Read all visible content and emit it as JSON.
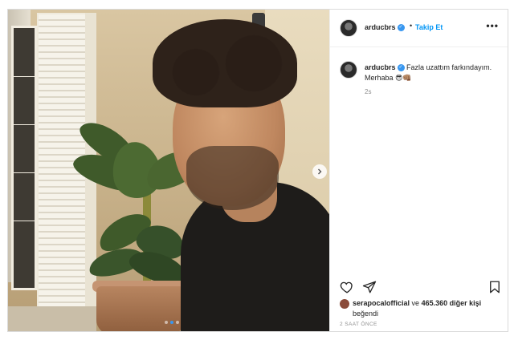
{
  "post": {
    "username": "arducbrs",
    "follow_label": "Takip Et",
    "separator": "•",
    "more_icon": "•••",
    "caption_username": "arducbrs",
    "caption_text": "Fazla uzattım farkındayım. Merhaba 😎👊🏽",
    "caption_time": "2s",
    "likes_user": "serapocalofficial",
    "likes_connector": "ve",
    "likes_count": "465.360 diğer kişi",
    "likes_suffix": "beğendi",
    "posted_ago": "2 SAAT ÖNCE",
    "carousel": {
      "slide_count": 3,
      "active_index": 1
    }
  },
  "colors": {
    "accent": "#0095f6",
    "verified": "#3897f0",
    "text": "#262626",
    "muted": "#8e8e8e",
    "border": "#dbdbdb"
  },
  "icons": {
    "verified": "verified-badge-icon",
    "more": "more-options-icon",
    "like": "heart-icon",
    "share": "paper-plane-icon",
    "save": "bookmark-icon",
    "next": "chevron-right-icon"
  }
}
